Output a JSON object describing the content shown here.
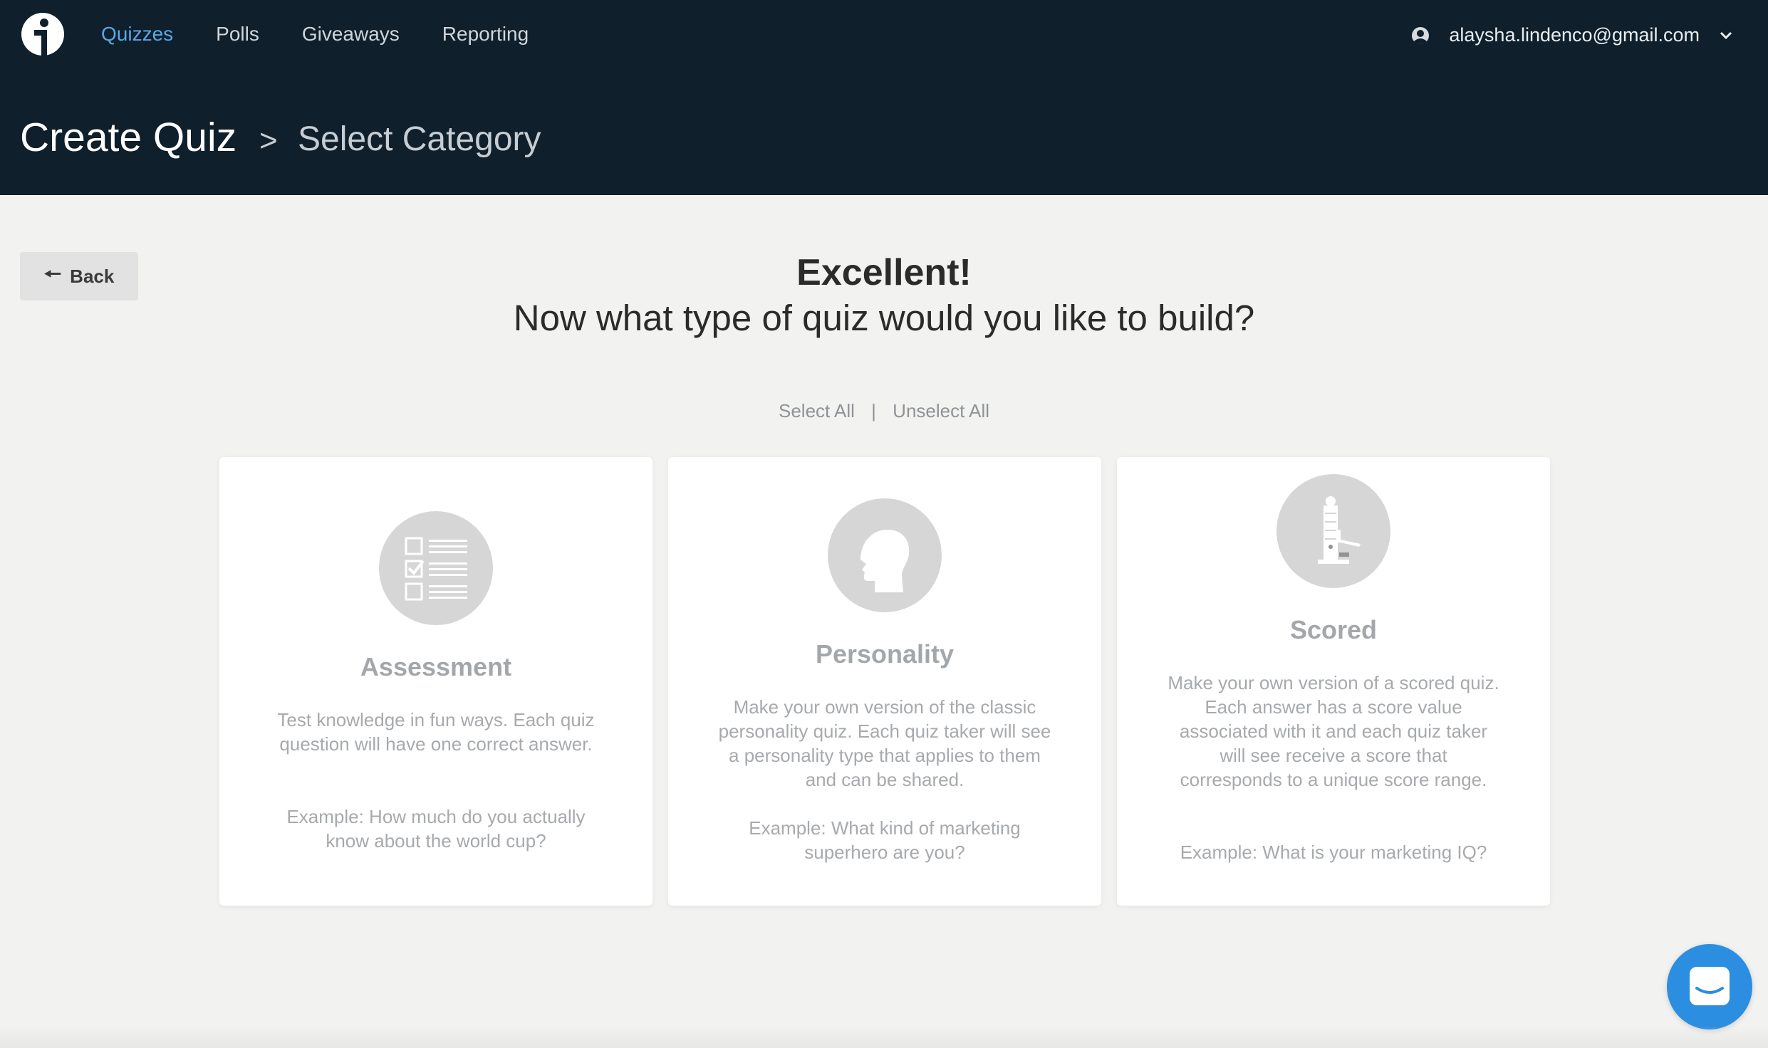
{
  "nav": {
    "items": [
      {
        "label": "Quizzes",
        "active": true
      },
      {
        "label": "Polls",
        "active": false
      },
      {
        "label": "Giveaways",
        "active": false
      },
      {
        "label": "Reporting",
        "active": false
      }
    ],
    "user_email": "alaysha.lindenco@gmail.com"
  },
  "breadcrumb": {
    "title": "Create Quiz",
    "separator": ">",
    "current": "Select Category"
  },
  "back_button": {
    "label": "Back",
    "icon": "arrow-left-icon"
  },
  "heading": {
    "line1": "Excellent!",
    "line2": "Now what type of quiz would you like to build?"
  },
  "selection": {
    "select_all": "Select All",
    "divider": "|",
    "unselect_all": "Unselect All"
  },
  "cards": [
    {
      "icon": "checklist-icon",
      "title": "Assessment",
      "description": "Test knowledge in fun ways. Each quiz question will have one correct answer.",
      "example": "Example: How much do you actually know about the world cup?"
    },
    {
      "icon": "head-silhouette-icon",
      "title": "Personality",
      "description": "Make your own version of the classic personality quiz. Each quiz taker will see a personality type that applies to them and can be shared.",
      "example": "Example: What kind of marketing superhero are you?"
    },
    {
      "icon": "strength-tester-icon",
      "title": "Scored",
      "description": "Make your own version of a scored quiz. Each answer has a score value associated with it and each quiz taker will see receive a score that corresponds to a unique score range.",
      "example": "Example: What is your marketing IQ?"
    }
  ],
  "colors": {
    "header_bg": "#0f1f2b",
    "active_nav": "#58a9e6",
    "page_bg": "#f2f2f1",
    "chat_button": "#2c8ee0"
  },
  "chat": {
    "icon": "chat-icon"
  }
}
